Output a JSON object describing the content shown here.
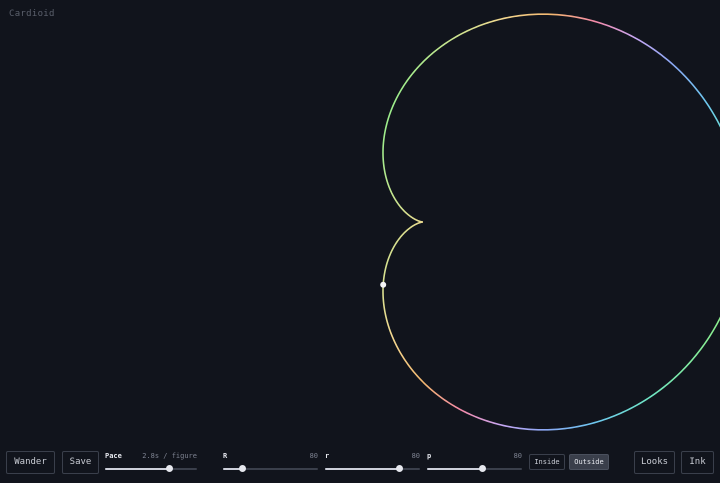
{
  "app": {
    "title": "Cardioid"
  },
  "curve": {
    "colors": [
      "#8ef08a",
      "#6fe6c4",
      "#6ec8f0",
      "#8aa8f4",
      "#c8a8f4",
      "#f48aa8",
      "#f4b870",
      "#f4d890",
      "#c8e690",
      "#8ef08a"
    ]
  },
  "toolbar": {
    "wander_label": "Wander",
    "save_label": "Save",
    "looks_label": "Looks",
    "ink_label": "Ink"
  },
  "pace": {
    "label": "Pace",
    "value": "2.8s / figure",
    "level": 0.7
  },
  "big_r": {
    "label": "R",
    "value": "80",
    "level": 0.2
  },
  "small_r": {
    "label": "r",
    "value": "80",
    "level": 0.78
  },
  "p": {
    "label": "p",
    "value": "80",
    "level": 0.58
  },
  "mode": {
    "inside_label": "Inside",
    "outside_label": "Outside",
    "selected": "Outside"
  }
}
